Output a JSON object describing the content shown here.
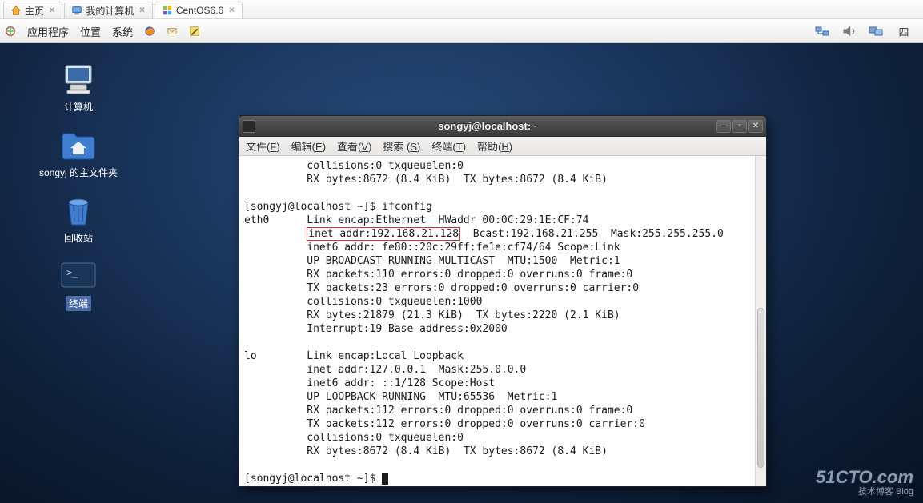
{
  "host_tabs": [
    {
      "label": "主页",
      "icon": "home-icon"
    },
    {
      "label": "我的计算机",
      "icon": "computer-icon"
    },
    {
      "label": "CentOS6.6",
      "icon": "centos-icon",
      "active": true
    }
  ],
  "gnome_panel": {
    "menus": [
      "应用程序",
      "位置",
      "系统"
    ],
    "tray": [
      "network-icon",
      "sound-icon",
      "dualscreen-icon",
      "calendar-icon"
    ]
  },
  "desktop_icons": {
    "computer": "计算机",
    "home": "songyj 的主文件夹",
    "trash": "回收站",
    "terminal": "终端"
  },
  "terminal_window": {
    "title": "songyj@localhost:~",
    "menus": [
      {
        "text": "文件",
        "key": "F"
      },
      {
        "text": "编辑",
        "key": "E"
      },
      {
        "text": "查看",
        "key": "V"
      },
      {
        "text": "搜索 ",
        "key": "S"
      },
      {
        "text": "终端",
        "key": "T"
      },
      {
        "text": "帮助",
        "key": "H"
      }
    ],
    "lines_top": [
      "          collisions:0 txqueuelen:0",
      "          RX bytes:8672 (8.4 KiB)  TX bytes:8672 (8.4 KiB)",
      "",
      "[songyj@localhost ~]$ ifconfig",
      "eth0      Link encap:Ethernet  HWaddr 00:0C:29:1E:CF:74"
    ],
    "inet_prefix": "          ",
    "inet_highlight": "inet addr:192.168.21.128",
    "inet_suffix": "  Bcast:192.168.21.255  Mask:255.255.255.0",
    "lines_mid": [
      "          inet6 addr: fe80::20c:29ff:fe1e:cf74/64 Scope:Link",
      "          UP BROADCAST RUNNING MULTICAST  MTU:1500  Metric:1",
      "          RX packets:110 errors:0 dropped:0 overruns:0 frame:0",
      "          TX packets:23 errors:0 dropped:0 overruns:0 carrier:0",
      "          collisions:0 txqueuelen:1000",
      "          RX bytes:21879 (21.3 KiB)  TX bytes:2220 (2.1 KiB)",
      "          Interrupt:19 Base address:0x2000",
      "",
      "lo        Link encap:Local Loopback",
      "          inet addr:127.0.0.1  Mask:255.0.0.0",
      "          inet6 addr: ::1/128 Scope:Host",
      "          UP LOOPBACK RUNNING  MTU:65536  Metric:1",
      "          RX packets:112 errors:0 dropped:0 overruns:0 frame:0",
      "          TX packets:112 errors:0 dropped:0 overruns:0 carrier:0",
      "          collisions:0 txqueuelen:0",
      "          RX bytes:8672 (8.4 KiB)  TX bytes:8672 (8.4 KiB)",
      ""
    ],
    "prompt": "[songyj@localhost ~]$ "
  },
  "watermark": {
    "main": "51CTO.com",
    "sub": "技术博客    Blog"
  }
}
